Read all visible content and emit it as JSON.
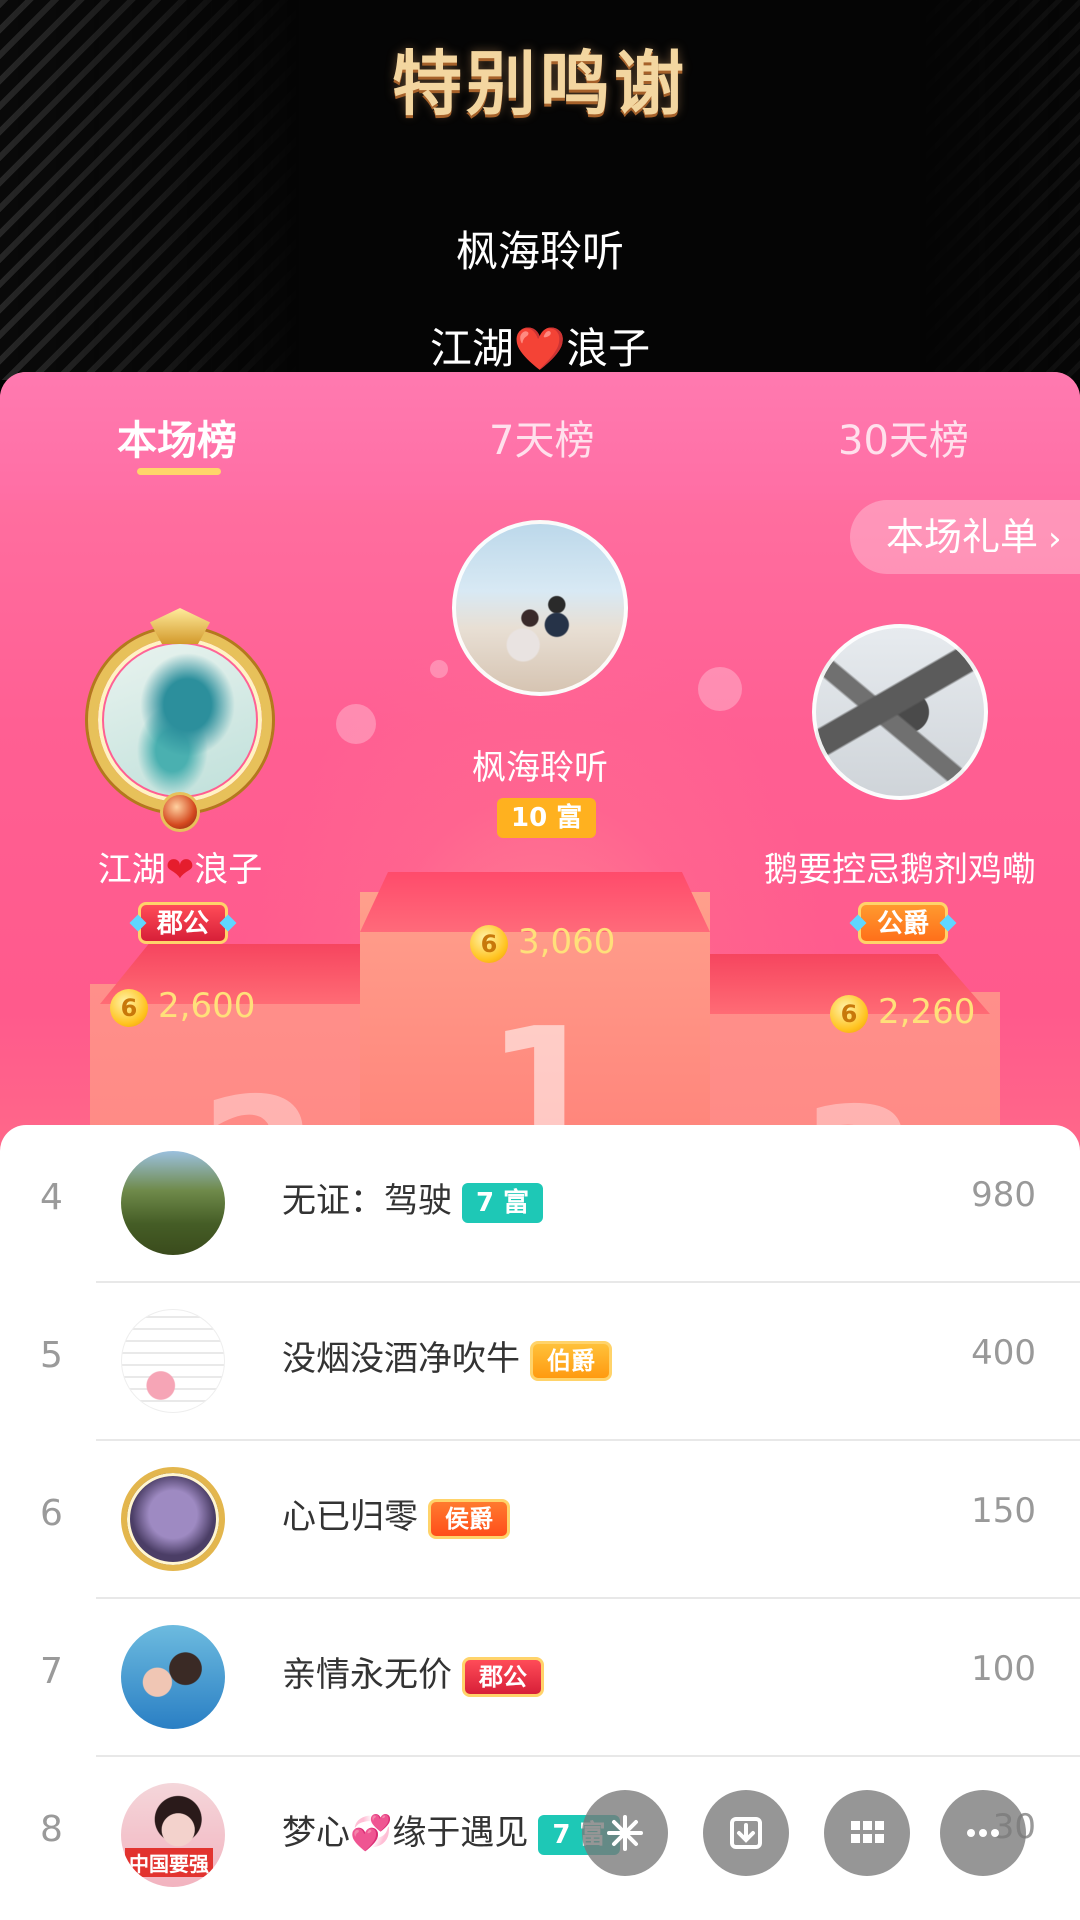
{
  "banner": {
    "title": "特别鸣谢",
    "names": [
      "枫海聆听",
      "江湖❤️浪子"
    ]
  },
  "tabs": [
    {
      "label": "本场榜",
      "active": true
    },
    {
      "label": "7天榜",
      "active": false
    },
    {
      "label": "30天榜",
      "active": false
    }
  ],
  "gift_list_button": "本场礼单",
  "podium": {
    "first": {
      "name": "枫海聆听",
      "level": "10 富",
      "coins": "3,060"
    },
    "second": {
      "name_left": "江湖",
      "name_right": "浪子",
      "title": "郡公",
      "coins": "2,600"
    },
    "third": {
      "name": "鹅要控忌鹅剂鸡嘞",
      "title": "公爵",
      "coins": "2,260"
    },
    "numbers": [
      "1",
      "2",
      "3"
    ],
    "coin_symbol": "6"
  },
  "list": [
    {
      "rank": "4",
      "name": "无证：驾驶",
      "badge": "7 富",
      "badge_type": "level",
      "score": "980"
    },
    {
      "rank": "5",
      "name": "没烟没酒净吹牛",
      "badge": "伯爵",
      "badge_type": "title",
      "score": "400"
    },
    {
      "rank": "6",
      "name": "心已归零",
      "badge": "侯爵",
      "badge_type": "title",
      "score": "150"
    },
    {
      "rank": "7",
      "name": "亲情永无价",
      "badge": "郡公",
      "badge_type": "title",
      "score": "100"
    },
    {
      "rank": "8",
      "name_left": "梦心",
      "name_right": "缘于遇见",
      "badge": "7 富",
      "badge_type": "level",
      "score": "30",
      "avatar_text": "中国要强"
    }
  ],
  "fabs": [
    "sparkle-icon",
    "download-icon",
    "grid-icon",
    "more-icon"
  ],
  "colors": {
    "accent_pink": "#ff5f93",
    "coin_yellow": "#ffc21e",
    "level_teal": "#1ec8b6"
  }
}
